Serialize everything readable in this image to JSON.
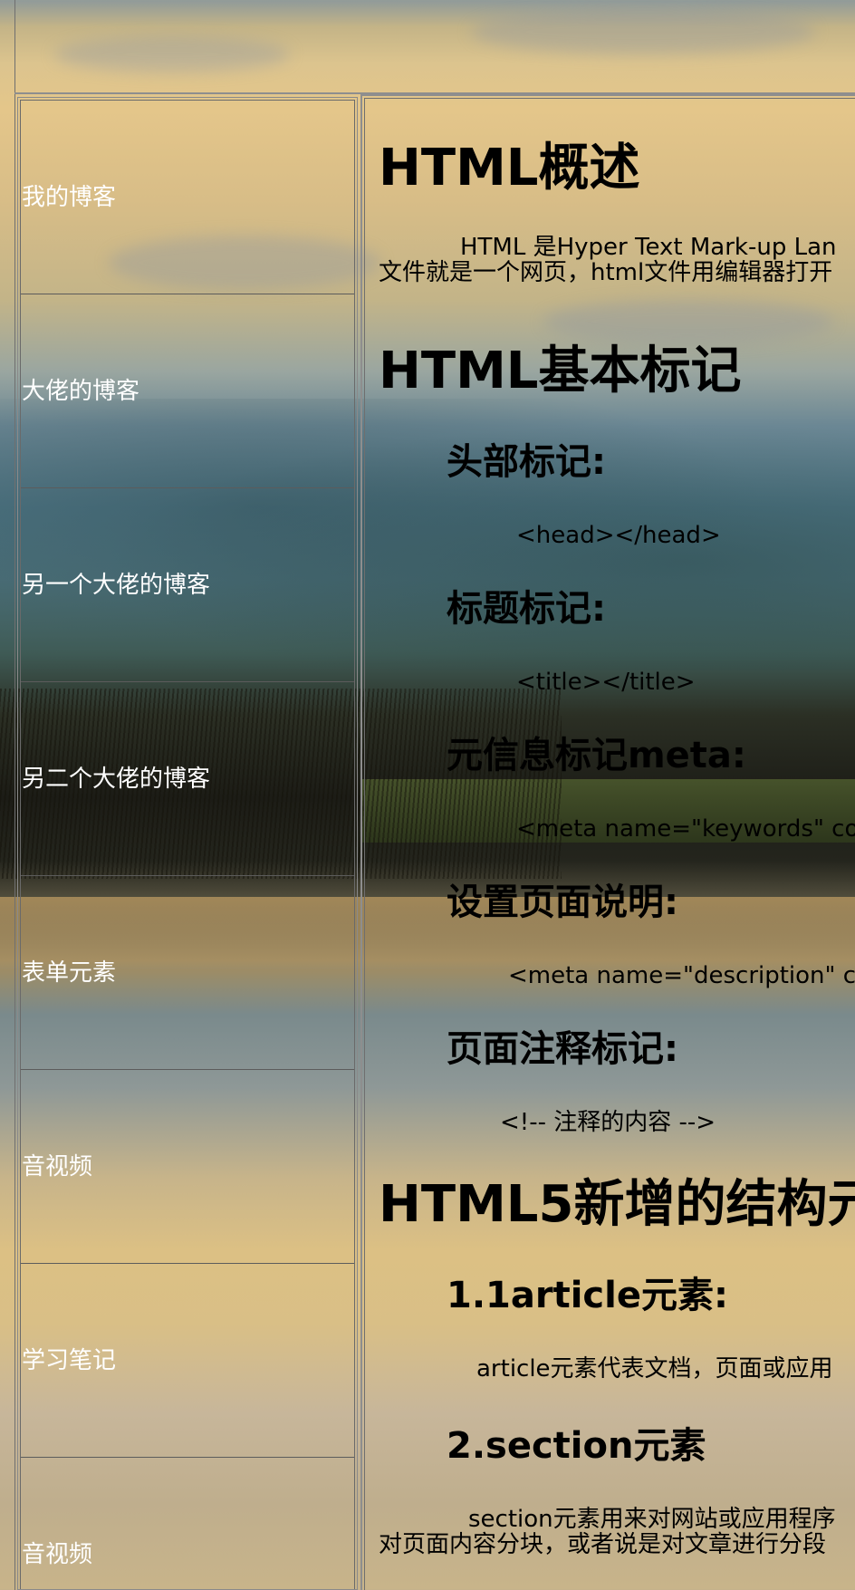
{
  "sidebar": {
    "items": [
      {
        "label": "我的博客"
      },
      {
        "label": "大佬的博客"
      },
      {
        "label": "另一个大佬的博客"
      },
      {
        "label": "另二个大佬的博客"
      },
      {
        "label": "表单元素"
      },
      {
        "label": "音视频"
      },
      {
        "label": "学习笔记"
      },
      {
        "label": "音视频"
      }
    ]
  },
  "main": {
    "section1": {
      "title": "HTML概述",
      "para_line1": "HTML 是Hyper Text Mark-up Lan",
      "para_line2": "文件就是一个网页，html文件用编辑器打开"
    },
    "section2": {
      "title": "HTML基本标记",
      "items": [
        {
          "heading": "头部标记:",
          "code": "<head></head>"
        },
        {
          "heading": "标题标记:",
          "code": "<title></title>"
        },
        {
          "heading": "元信息标记meta:",
          "code": "<meta name=\"keywords\" co"
        },
        {
          "heading": "设置页面说明:",
          "code": "<meta name=\"description\" c"
        },
        {
          "heading": "页面注释标记:",
          "code": "<!-- 注释的内容 -->"
        }
      ]
    },
    "section3": {
      "title": "HTML5新增的结构元",
      "items": [
        {
          "heading": "1.1article元素:",
          "text": "article元素代表文档，页面或应用"
        },
        {
          "heading": "2.section元素",
          "text_line1": "section元素用来对网站或应用程序",
          "text_line2": "对页面内容分块，或者说是对文章进行分段"
        }
      ]
    }
  }
}
